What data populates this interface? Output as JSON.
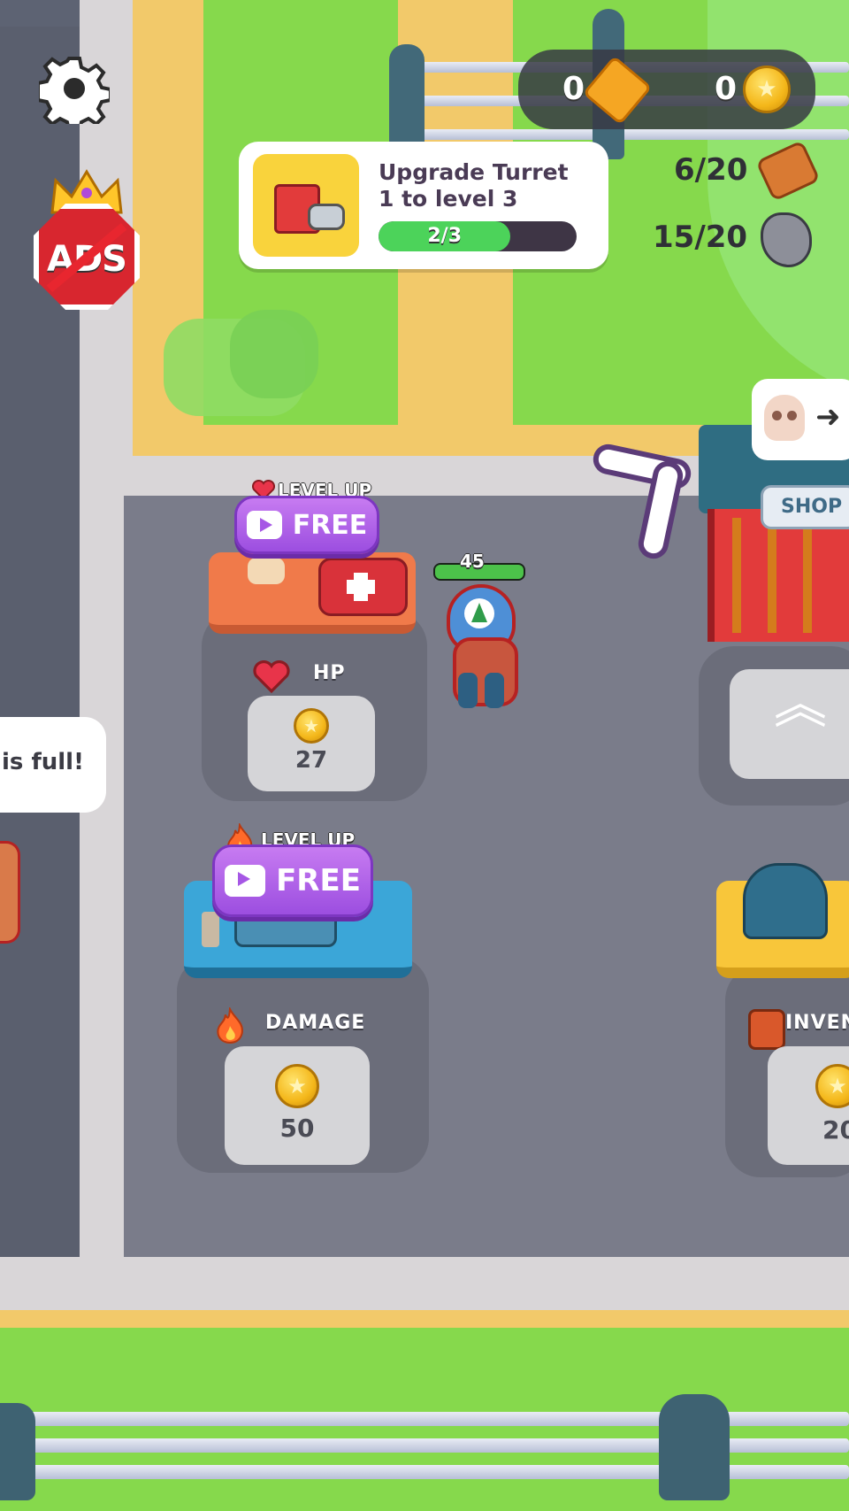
{
  "hud": {
    "tickets_count": "0",
    "coins_count": "0",
    "wood": "6/20",
    "stone": "15/20"
  },
  "quest": {
    "title_line1": "Upgrade Turret",
    "title_line2": "1 to level 3",
    "progress_text": "2/3",
    "progress_fraction": 0.667
  },
  "player": {
    "hp": "45"
  },
  "stations": {
    "hp": {
      "level_up_label": "LEVEL UP",
      "free_label": "FREE",
      "name": "HP",
      "price": "27"
    },
    "damage": {
      "level_up_label": "LEVEL UP",
      "free_label": "FREE",
      "name": "DAMAGE",
      "price": "50"
    },
    "inventory": {
      "name": "INVEN",
      "price": "20"
    }
  },
  "shop": {
    "sign": "SHOP"
  },
  "notification": {
    "text": "is full!"
  },
  "ads_badge": {
    "text": "ADS"
  },
  "colors": {
    "grass": "#86d94c",
    "path": "#f2c96a",
    "floor": "#7a7c8a",
    "free_button": "#a657e5",
    "progress": "#4cd35a",
    "hud_panel": "#3d3f4a"
  }
}
